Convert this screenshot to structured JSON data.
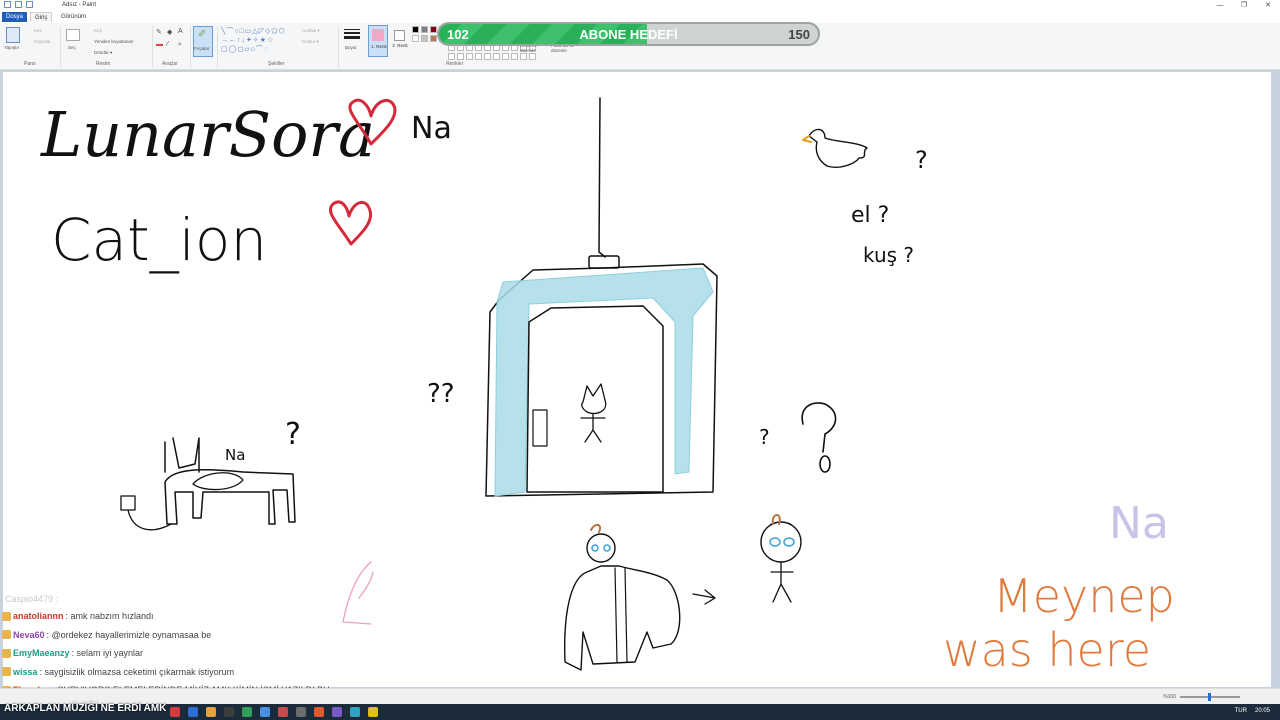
{
  "window": {
    "title": "Adsız - Paint",
    "controls": [
      "—",
      "❐",
      "✕"
    ]
  },
  "menu": {
    "file": "Dosya",
    "home": "Giriş",
    "view": "Görünüm"
  },
  "ribbon": {
    "clipboard": {
      "paste": "Yapıştır",
      "cut": "Kes",
      "copy": "Kopyala",
      "label": "Pano"
    },
    "image": {
      "select": "Seç",
      "crop": "Kırp",
      "resize": "Yeniden boyutlandır",
      "rotate": "Döndür ▾",
      "label": "Resim"
    },
    "tools": {
      "label": "Araçlar"
    },
    "brushes": {
      "label": "Fırçalar"
    },
    "shapes": {
      "outline": "Anahat ▾",
      "fill": "Doldur ▾",
      "label": "Şekiller"
    },
    "size": {
      "label": "Boyut"
    },
    "colors": {
      "color1": "1. Renk",
      "color2": "2. Renk",
      "edit": "Renkleri düzenle",
      "edit3d": "Paint 3D ile düzenle",
      "label": "Renkler",
      "color1_hex": "#f4a6c8",
      "palette": [
        "#000000",
        "#7f7f7f",
        "#880015",
        "#ed1c24",
        "#ffffff",
        "#c3c3c3",
        "#b97a57",
        "#ffaec9"
      ]
    }
  },
  "goal": {
    "current": "102",
    "label": "ABONE HEDEFİ",
    "target": "150",
    "progress": 0.55,
    "fill_color": "#2bb05a"
  },
  "drawing": {
    "name1": "LunarSora",
    "na1": "Na",
    "name2": "Cat_ion",
    "na2": "Na",
    "question_cat": "?",
    "q_left": "??",
    "el": "el ?",
    "kus": "kuş ?",
    "q_bird": "?",
    "q_right": "?",
    "na_faded": "Na",
    "meynep": "Meynep",
    "was_here": "was here",
    "heart_color": "#d42a3a",
    "door_color": "#a9dce8",
    "signature_color": "#e07a3c"
  },
  "chat": {
    "header": "Caspio4479 :",
    "messages": [
      {
        "user": "anatoliannn",
        "text": ": amk nabzım hızlandı",
        "color": "#c0392b"
      },
      {
        "user": "Neva60",
        "text": ": @ordekez hayallerimizle oynamasaa be",
        "color": "#8e44ad"
      },
      {
        "user": "EmyMaeanzy",
        "text": ": selam iyi yaynlar",
        "color": "#16a085"
      },
      {
        "user": "wissa",
        "text": ": saygisizlik olmazsa ceketimi çıkarmak istiyorum",
        "color": "#16a085"
      },
      {
        "user": "Thyrelox",
        "text": ": SURVIVORS ELEMELERİNDE MİYİZ AMK KİMİN İSMİ YAZILDI BU",
        "color": "#d35400"
      }
    ]
  },
  "caption": "ARKAPLAN MÜZİĞİ NE ERDİ AMK",
  "status": {
    "zoom": "%100"
  },
  "tray": {
    "lang": "TUR",
    "time": "20:05"
  }
}
